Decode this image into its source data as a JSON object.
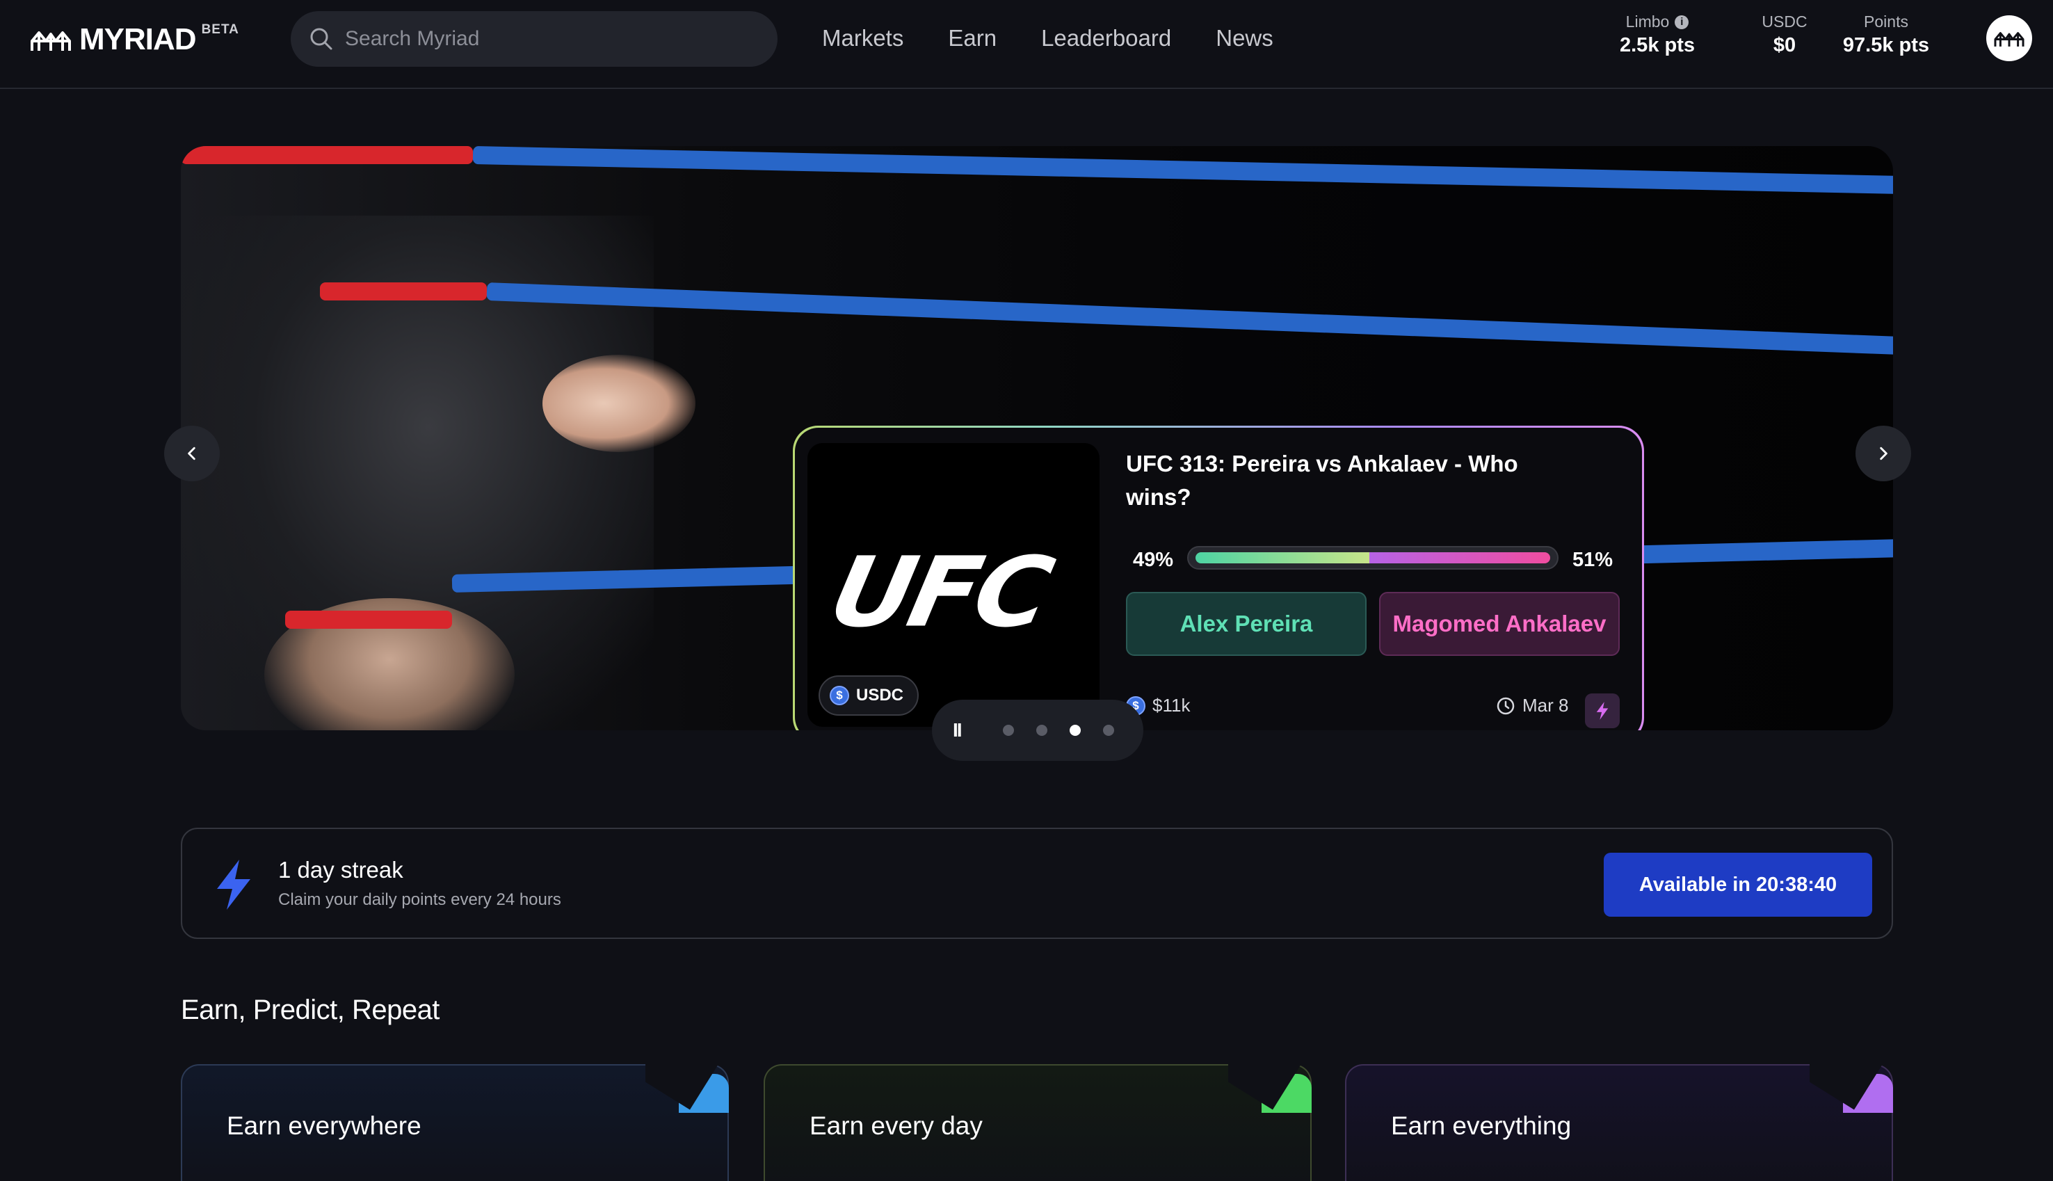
{
  "header": {
    "logo_text": "MYRIAD",
    "logo_badge": "BETA",
    "search_placeholder": "Search Myriad",
    "nav": [
      "Markets",
      "Earn",
      "Leaderboard",
      "News"
    ],
    "stats": {
      "limbo": {
        "label": "Limbo",
        "value": "2.5k pts"
      },
      "usdc": {
        "label": "USDC",
        "value": "$0"
      },
      "points": {
        "label": "Points",
        "value": "97.5k pts"
      }
    }
  },
  "hero": {
    "market": {
      "image_text": "UFC",
      "currency": "USDC",
      "title": "UFC 313: Pereira vs Ankalaev - Who wins?",
      "left_pct": "49%",
      "right_pct": "51%",
      "left_share": 0.49,
      "option_a": "Alex Pereira",
      "option_b": "Magomed Ankalaev",
      "volume": "$11k",
      "date": "Mar 8"
    },
    "pager": {
      "pause": "II",
      "slides": 4,
      "active": 3
    }
  },
  "streak": {
    "title": "1 day streak",
    "subtitle": "Claim your daily points every 24 hours",
    "button": "Available in 20:38:40"
  },
  "earn": {
    "title": "Earn, Predict, Repeat",
    "cards": [
      {
        "title": "Earn everywhere",
        "accent": "#3a9be8"
      },
      {
        "title": "Earn every day",
        "accent": "#4cd964"
      },
      {
        "title": "Earn everything",
        "accent": "#b06ef0"
      }
    ]
  },
  "colors": {
    "background": "#0f1016",
    "primary_button": "#1e3cc4",
    "option_a": "#5fe0b5",
    "option_b": "#ff6ec7"
  }
}
